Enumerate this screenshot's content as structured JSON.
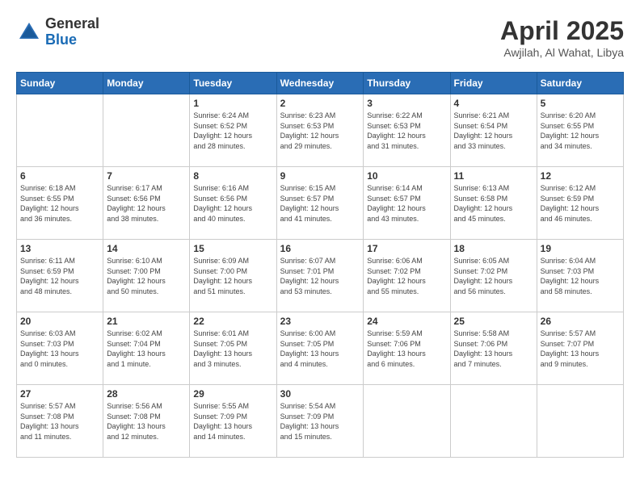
{
  "header": {
    "logo_general": "General",
    "logo_blue": "Blue",
    "month_title": "April 2025",
    "location": "Awjilah, Al Wahat, Libya"
  },
  "weekdays": [
    "Sunday",
    "Monday",
    "Tuesday",
    "Wednesday",
    "Thursday",
    "Friday",
    "Saturday"
  ],
  "weeks": [
    [
      {
        "day": "",
        "info": ""
      },
      {
        "day": "",
        "info": ""
      },
      {
        "day": "1",
        "info": "Sunrise: 6:24 AM\nSunset: 6:52 PM\nDaylight: 12 hours\nand 28 minutes."
      },
      {
        "day": "2",
        "info": "Sunrise: 6:23 AM\nSunset: 6:53 PM\nDaylight: 12 hours\nand 29 minutes."
      },
      {
        "day": "3",
        "info": "Sunrise: 6:22 AM\nSunset: 6:53 PM\nDaylight: 12 hours\nand 31 minutes."
      },
      {
        "day": "4",
        "info": "Sunrise: 6:21 AM\nSunset: 6:54 PM\nDaylight: 12 hours\nand 33 minutes."
      },
      {
        "day": "5",
        "info": "Sunrise: 6:20 AM\nSunset: 6:55 PM\nDaylight: 12 hours\nand 34 minutes."
      }
    ],
    [
      {
        "day": "6",
        "info": "Sunrise: 6:18 AM\nSunset: 6:55 PM\nDaylight: 12 hours\nand 36 minutes."
      },
      {
        "day": "7",
        "info": "Sunrise: 6:17 AM\nSunset: 6:56 PM\nDaylight: 12 hours\nand 38 minutes."
      },
      {
        "day": "8",
        "info": "Sunrise: 6:16 AM\nSunset: 6:56 PM\nDaylight: 12 hours\nand 40 minutes."
      },
      {
        "day": "9",
        "info": "Sunrise: 6:15 AM\nSunset: 6:57 PM\nDaylight: 12 hours\nand 41 minutes."
      },
      {
        "day": "10",
        "info": "Sunrise: 6:14 AM\nSunset: 6:57 PM\nDaylight: 12 hours\nand 43 minutes."
      },
      {
        "day": "11",
        "info": "Sunrise: 6:13 AM\nSunset: 6:58 PM\nDaylight: 12 hours\nand 45 minutes."
      },
      {
        "day": "12",
        "info": "Sunrise: 6:12 AM\nSunset: 6:59 PM\nDaylight: 12 hours\nand 46 minutes."
      }
    ],
    [
      {
        "day": "13",
        "info": "Sunrise: 6:11 AM\nSunset: 6:59 PM\nDaylight: 12 hours\nand 48 minutes."
      },
      {
        "day": "14",
        "info": "Sunrise: 6:10 AM\nSunset: 7:00 PM\nDaylight: 12 hours\nand 50 minutes."
      },
      {
        "day": "15",
        "info": "Sunrise: 6:09 AM\nSunset: 7:00 PM\nDaylight: 12 hours\nand 51 minutes."
      },
      {
        "day": "16",
        "info": "Sunrise: 6:07 AM\nSunset: 7:01 PM\nDaylight: 12 hours\nand 53 minutes."
      },
      {
        "day": "17",
        "info": "Sunrise: 6:06 AM\nSunset: 7:02 PM\nDaylight: 12 hours\nand 55 minutes."
      },
      {
        "day": "18",
        "info": "Sunrise: 6:05 AM\nSunset: 7:02 PM\nDaylight: 12 hours\nand 56 minutes."
      },
      {
        "day": "19",
        "info": "Sunrise: 6:04 AM\nSunset: 7:03 PM\nDaylight: 12 hours\nand 58 minutes."
      }
    ],
    [
      {
        "day": "20",
        "info": "Sunrise: 6:03 AM\nSunset: 7:03 PM\nDaylight: 13 hours\nand 0 minutes."
      },
      {
        "day": "21",
        "info": "Sunrise: 6:02 AM\nSunset: 7:04 PM\nDaylight: 13 hours\nand 1 minute."
      },
      {
        "day": "22",
        "info": "Sunrise: 6:01 AM\nSunset: 7:05 PM\nDaylight: 13 hours\nand 3 minutes."
      },
      {
        "day": "23",
        "info": "Sunrise: 6:00 AM\nSunset: 7:05 PM\nDaylight: 13 hours\nand 4 minutes."
      },
      {
        "day": "24",
        "info": "Sunrise: 5:59 AM\nSunset: 7:06 PM\nDaylight: 13 hours\nand 6 minutes."
      },
      {
        "day": "25",
        "info": "Sunrise: 5:58 AM\nSunset: 7:06 PM\nDaylight: 13 hours\nand 7 minutes."
      },
      {
        "day": "26",
        "info": "Sunrise: 5:57 AM\nSunset: 7:07 PM\nDaylight: 13 hours\nand 9 minutes."
      }
    ],
    [
      {
        "day": "27",
        "info": "Sunrise: 5:57 AM\nSunset: 7:08 PM\nDaylight: 13 hours\nand 11 minutes."
      },
      {
        "day": "28",
        "info": "Sunrise: 5:56 AM\nSunset: 7:08 PM\nDaylight: 13 hours\nand 12 minutes."
      },
      {
        "day": "29",
        "info": "Sunrise: 5:55 AM\nSunset: 7:09 PM\nDaylight: 13 hours\nand 14 minutes."
      },
      {
        "day": "30",
        "info": "Sunrise: 5:54 AM\nSunset: 7:09 PM\nDaylight: 13 hours\nand 15 minutes."
      },
      {
        "day": "",
        "info": ""
      },
      {
        "day": "",
        "info": ""
      },
      {
        "day": "",
        "info": ""
      }
    ]
  ]
}
